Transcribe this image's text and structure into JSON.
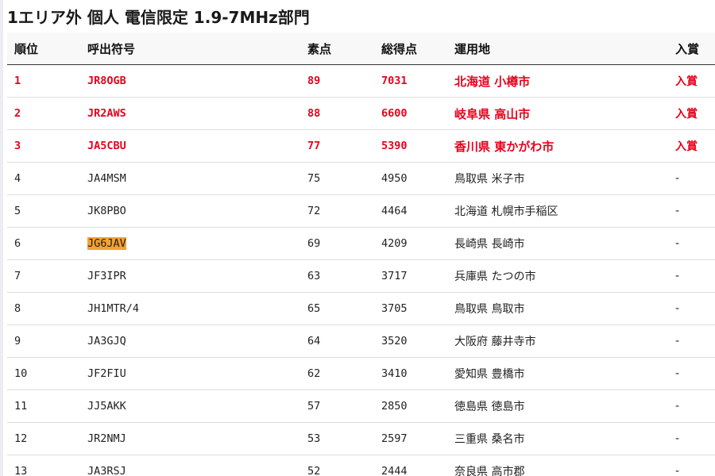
{
  "title": "1エリア外 個人 電信限定 1.9-7MHz部門",
  "columns": {
    "rank": "順位",
    "callsign": "呼出符号",
    "raw": "素点",
    "total": "総得点",
    "location": "運用地",
    "award": "入賞"
  },
  "rows": [
    {
      "rank": "1",
      "callsign": "JR8OGB",
      "raw": "89",
      "total": "7031",
      "location": "北海道 小樽市",
      "award": "入賞",
      "prize": true
    },
    {
      "rank": "2",
      "callsign": "JR2AWS",
      "raw": "88",
      "total": "6600",
      "location": "岐阜県 高山市",
      "award": "入賞",
      "prize": true
    },
    {
      "rank": "3",
      "callsign": "JA5CBU",
      "raw": "77",
      "total": "5390",
      "location": "香川県 東かがわ市",
      "award": "入賞",
      "prize": true
    },
    {
      "rank": "4",
      "callsign": "JA4MSM",
      "raw": "75",
      "total": "4950",
      "location": "鳥取県 米子市",
      "award": "-"
    },
    {
      "rank": "5",
      "callsign": "JK8PBO",
      "raw": "72",
      "total": "4464",
      "location": "北海道 札幌市手稲区",
      "award": "-"
    },
    {
      "rank": "6",
      "callsign": "JG6JAV",
      "raw": "69",
      "total": "4209",
      "location": "長崎県 長崎市",
      "award": "-",
      "highlight": true
    },
    {
      "rank": "7",
      "callsign": "JF3IPR",
      "raw": "63",
      "total": "3717",
      "location": "兵庫県 たつの市",
      "award": "-"
    },
    {
      "rank": "8",
      "callsign": "JH1MTR/4",
      "raw": "65",
      "total": "3705",
      "location": "鳥取県 鳥取市",
      "award": "-"
    },
    {
      "rank": "9",
      "callsign": "JA3GJQ",
      "raw": "64",
      "total": "3520",
      "location": "大阪府 藤井寺市",
      "award": "-"
    },
    {
      "rank": "10",
      "callsign": "JF2FIU",
      "raw": "62",
      "total": "3410",
      "location": "愛知県 豊橋市",
      "award": "-"
    },
    {
      "rank": "11",
      "callsign": "JJ5AKK",
      "raw": "57",
      "total": "2850",
      "location": "徳島県 徳島市",
      "award": "-"
    },
    {
      "rank": "12",
      "callsign": "JR2NMJ",
      "raw": "53",
      "total": "2597",
      "location": "三重県 桑名市",
      "award": "-"
    },
    {
      "rank": "13",
      "callsign": "JA3RSJ",
      "raw": "52",
      "total": "2444",
      "location": "奈良県 高市郡",
      "award": "-"
    }
  ],
  "colors": {
    "prize_text": "#e8001c",
    "highlight_bg": "#f5a030"
  }
}
